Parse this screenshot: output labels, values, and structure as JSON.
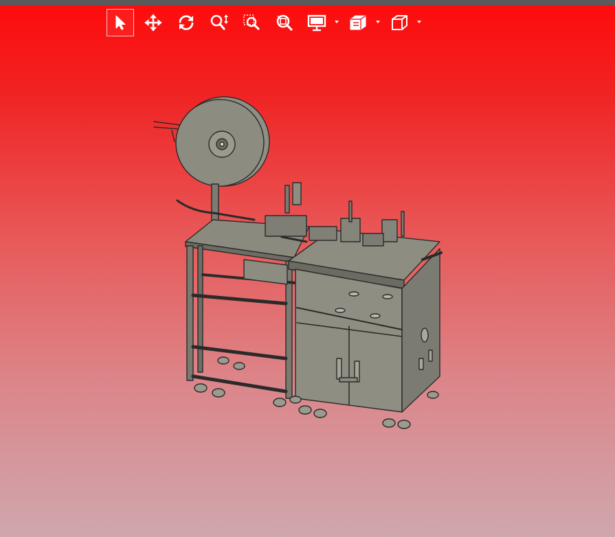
{
  "colors": {
    "toolbar_icon": "#ffffff",
    "top_strip": "#5a5a5a",
    "background_top": "#ff0a0a",
    "background_bottom": "#cfa7ae",
    "machine_fill": "#8f8f84",
    "machine_outline": "#2a2a2a"
  },
  "toolbar": {
    "tools": [
      {
        "id": "select",
        "icon": "cursor-arrow-icon",
        "active": true
      },
      {
        "id": "pan",
        "icon": "move-arrows-icon",
        "active": false
      },
      {
        "id": "rotate",
        "icon": "rotate-icon",
        "active": false
      },
      {
        "id": "zoom",
        "icon": "zoom-icon",
        "active": false
      },
      {
        "id": "zoom-window",
        "icon": "zoom-window-icon",
        "active": false
      },
      {
        "id": "zoom-fit",
        "icon": "zoom-fit-icon",
        "active": false
      },
      {
        "id": "display-mode",
        "icon": "monitor-icon",
        "dropdown": true
      },
      {
        "id": "section",
        "icon": "section-cube-icon",
        "dropdown": true
      },
      {
        "id": "view-orientation",
        "icon": "cube-view-icon",
        "dropdown": true
      }
    ]
  },
  "model": {
    "icon": "cad-machine-model"
  }
}
